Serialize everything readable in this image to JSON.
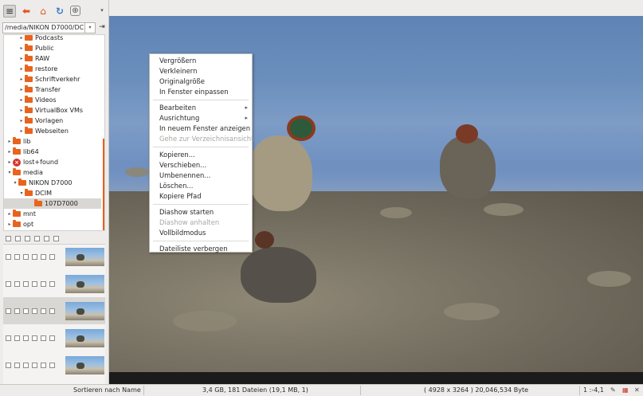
{
  "toolbar": {
    "items": [
      {
        "name": "list-view-icon",
        "glyph": "≡"
      },
      {
        "name": "back-arrow-icon",
        "glyph": "⬅"
      },
      {
        "name": "home-icon",
        "glyph": "⌂"
      },
      {
        "name": "reload-icon",
        "glyph": "↻"
      },
      {
        "name": "filter-icon",
        "glyph": "⊕"
      },
      {
        "name": "menu-dropdown-icon",
        "glyph": "▾"
      }
    ]
  },
  "path": {
    "value": "/media/NIKON D7000/DC",
    "dropdown_glyph": "▾",
    "go_glyph": "⇥"
  },
  "tree": [
    {
      "label": "Podcasts",
      "exp": "▸",
      "depth": 2,
      "type": "folder"
    },
    {
      "label": "Public",
      "exp": "▸",
      "depth": 2,
      "type": "folder"
    },
    {
      "label": "RAW",
      "exp": "▸",
      "depth": 2,
      "type": "folder"
    },
    {
      "label": "restore",
      "exp": "▸",
      "depth": 2,
      "type": "folder"
    },
    {
      "label": "Schriftverkehr",
      "exp": "▸",
      "depth": 2,
      "type": "folder"
    },
    {
      "label": "Transfer",
      "exp": "▸",
      "depth": 2,
      "type": "folder"
    },
    {
      "label": "Videos",
      "exp": "▸",
      "depth": 2,
      "type": "folder"
    },
    {
      "label": "VirtualBox VMs",
      "exp": "▸",
      "depth": 2,
      "type": "folder"
    },
    {
      "label": "Vorlagen",
      "exp": "▸",
      "depth": 2,
      "type": "folder"
    },
    {
      "label": "Webseiten",
      "exp": "▸",
      "depth": 2,
      "type": "folder"
    },
    {
      "label": "lib",
      "exp": "▸",
      "depth": 0,
      "type": "folder"
    },
    {
      "label": "lib64",
      "exp": "▸",
      "depth": 0,
      "type": "folder"
    },
    {
      "label": "lost+found",
      "exp": "▸",
      "depth": 0,
      "type": "restricted"
    },
    {
      "label": "media",
      "exp": "▾",
      "depth": 0,
      "type": "folder"
    },
    {
      "label": "NIKON D7000",
      "exp": "▾",
      "depth": 1,
      "type": "folder"
    },
    {
      "label": "DCIM",
      "exp": "▾",
      "depth": 2,
      "type": "folder"
    },
    {
      "label": "107D7000",
      "exp": "",
      "depth": 3,
      "type": "folder",
      "selected": true
    },
    {
      "label": "mnt",
      "exp": "▸",
      "depth": 0,
      "type": "folder"
    },
    {
      "label": "opt",
      "exp": "▸",
      "depth": 0,
      "type": "folder"
    }
  ],
  "file_rows": [
    {
      "selected": false
    },
    {
      "selected": false
    },
    {
      "selected": true
    },
    {
      "selected": false
    },
    {
      "selected": false
    }
  ],
  "context_menu": {
    "items": [
      {
        "label": "Vergrößern",
        "disabled": false,
        "submenu": false
      },
      {
        "label": "Verkleinern",
        "disabled": false,
        "submenu": false
      },
      {
        "label": "Originalgröße",
        "disabled": false,
        "submenu": false
      },
      {
        "label": "In Fenster einpassen",
        "disabled": false,
        "submenu": false
      },
      {
        "sep": true
      },
      {
        "label": "Bearbeiten",
        "disabled": false,
        "submenu": true
      },
      {
        "label": "Ausrichtung",
        "disabled": false,
        "submenu": true
      },
      {
        "label": "In neuem Fenster anzeigen",
        "disabled": false,
        "submenu": false
      },
      {
        "label": "Gehe zur Verzeichnisansicht",
        "disabled": true,
        "submenu": false
      },
      {
        "sep": true
      },
      {
        "label": "Kopieren...",
        "disabled": false,
        "submenu": false
      },
      {
        "label": "Verschieben...",
        "disabled": false,
        "submenu": false
      },
      {
        "label": "Umbenennen...",
        "disabled": false,
        "submenu": false
      },
      {
        "label": "Löschen...",
        "disabled": false,
        "submenu": false
      },
      {
        "label": "Kopiere Pfad",
        "disabled": false,
        "submenu": false
      },
      {
        "sep": true
      },
      {
        "label": "Diashow starten",
        "disabled": false,
        "submenu": false
      },
      {
        "label": "Diashow anhalten",
        "disabled": true,
        "submenu": false
      },
      {
        "label": "Vollbildmodus",
        "disabled": false,
        "submenu": false
      },
      {
        "sep": true
      },
      {
        "label": "Dateiliste verbergen",
        "disabled": false,
        "submenu": false
      }
    ],
    "submenu_glyph": "▸"
  },
  "status": {
    "sort_label": "Sortieren nach Name",
    "summary": "3,4 GB, 181 Dateien (19,1 MB, 1)",
    "image_info": "( 4928 x 3264 ) 20,046,534 Byte",
    "zoom": "1 :-4,1",
    "pick_icon": "✎",
    "color_icon": "▦",
    "close_icon": "✕"
  },
  "colors": {
    "accent": "#e8641e",
    "restricted": "#d8322a",
    "selection": "#d9d7d3"
  }
}
